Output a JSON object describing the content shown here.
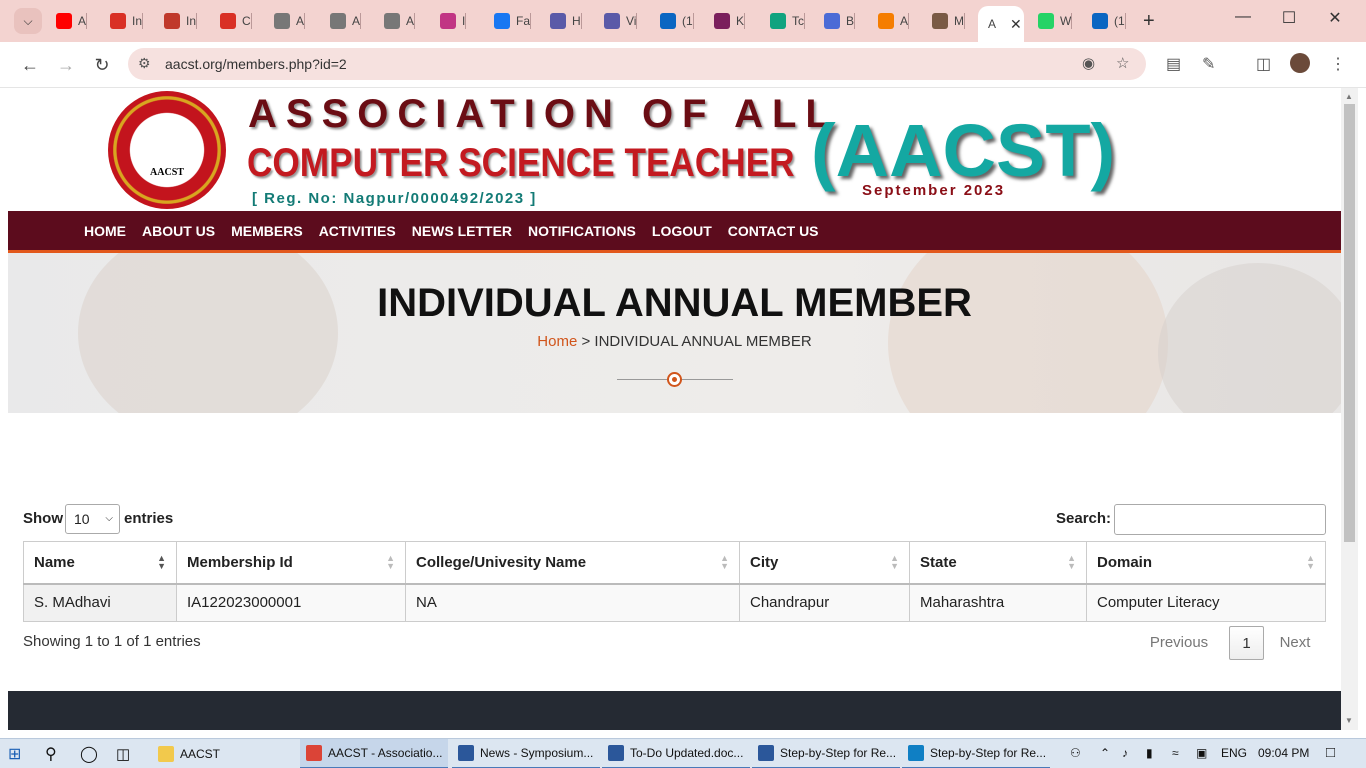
{
  "browser": {
    "tabs": [
      {
        "title": "A",
        "icon": "youtube-icon",
        "color": "#ff0000"
      },
      {
        "title": "In",
        "icon": "gmail-icon",
        "color": "#d93025"
      },
      {
        "title": "In",
        "icon": "tenplus-icon",
        "color": "#c0392b"
      },
      {
        "title": "C",
        "icon": "gmail-icon",
        "color": "#d93025"
      },
      {
        "title": "A",
        "icon": "globe-icon",
        "color": "#777777"
      },
      {
        "title": "A",
        "icon": "globe-icon",
        "color": "#777777"
      },
      {
        "title": "A",
        "icon": "globe-icon",
        "color": "#777777"
      },
      {
        "title": "I",
        "icon": "instagram-icon",
        "color": "#c13584"
      },
      {
        "title": "Fa",
        "icon": "facebook-icon",
        "color": "#1877f2"
      },
      {
        "title": "H",
        "icon": "openai-icon",
        "color": "#5a5aa8"
      },
      {
        "title": "Vi",
        "icon": "openai-icon",
        "color": "#5a5aa8"
      },
      {
        "title": "(1",
        "icon": "linkedin-icon",
        "color": "#0a66c2"
      },
      {
        "title": "K",
        "icon": "kle-icon",
        "color": "#7a1f5c"
      },
      {
        "title": "Tc",
        "icon": "chatgpt-icon",
        "color": "#10a37f"
      },
      {
        "title": "B",
        "icon": "sparkle-icon",
        "color": "#4b6bd6"
      },
      {
        "title": "A",
        "icon": "blogger-icon",
        "color": "#f57d00"
      },
      {
        "title": "M",
        "icon": "avatar-icon",
        "color": "#7a5a45"
      },
      {
        "title": "A",
        "icon": "",
        "color": "#ffffff"
      },
      {
        "title": "W",
        "icon": "whatsapp-icon",
        "color": "#25d366"
      },
      {
        "title": "(1",
        "icon": "linkedin-icon",
        "color": "#0a66c2"
      }
    ],
    "url": "aacst.org/members.php?id=2"
  },
  "header": {
    "line1": "ASSOCIATION OF ALL",
    "line2": "COMPUTER SCIENCE TEACHER",
    "reg": "[ Reg. No: Nagpur/0000492/2023 ]",
    "abbr": "(AACST)",
    "date": "September 2023",
    "seal_text": "AACST"
  },
  "nav": [
    "HOME",
    "ABOUT US",
    "MEMBERS",
    "ACTIVITIES",
    "NEWS LETTER",
    "NOTIFICATIONS",
    "LOGOUT",
    "CONTACT US"
  ],
  "banner": {
    "title": "INDIVIDUAL ANNUAL MEMBER",
    "crumb_home": "Home",
    "crumb_sep": " > ",
    "crumb_current": "INDIVIDUAL ANNUAL MEMBER"
  },
  "table_controls": {
    "show_label": "Show",
    "length_value": "10",
    "entries_label": "entries",
    "search_label": "Search:"
  },
  "table": {
    "columns": [
      "Name",
      "Membership Id",
      "College/Univesity Name",
      "City",
      "State",
      "Domain"
    ],
    "rows": [
      [
        "S. MAdhavi",
        "IA122023000001",
        "NA",
        "Chandrapur",
        "Maharashtra",
        "Computer Literacy"
      ]
    ]
  },
  "pagination": {
    "info": "Showing 1 to 1 of 1 entries",
    "previous": "Previous",
    "current": "1",
    "next": "Next"
  },
  "taskbar": {
    "items": [
      {
        "label": "AACST",
        "icon": "folder-icon",
        "color": "#f2c94c"
      },
      {
        "label": "AACST - Associatio...",
        "icon": "chrome-icon",
        "color": "#db4437"
      },
      {
        "label": "News - Symposium...",
        "icon": "word-icon",
        "color": "#2b579a"
      },
      {
        "label": "To-Do Updated.doc...",
        "icon": "word-icon",
        "color": "#2b579a"
      },
      {
        "label": "Step-by-Step for Re...",
        "icon": "word-icon",
        "color": "#2b579a"
      },
      {
        "label": "Step-by-Step for Re...",
        "icon": "edge-icon",
        "color": "#0f7fc4"
      }
    ],
    "language": "ENG",
    "time": "09:04 PM"
  }
}
